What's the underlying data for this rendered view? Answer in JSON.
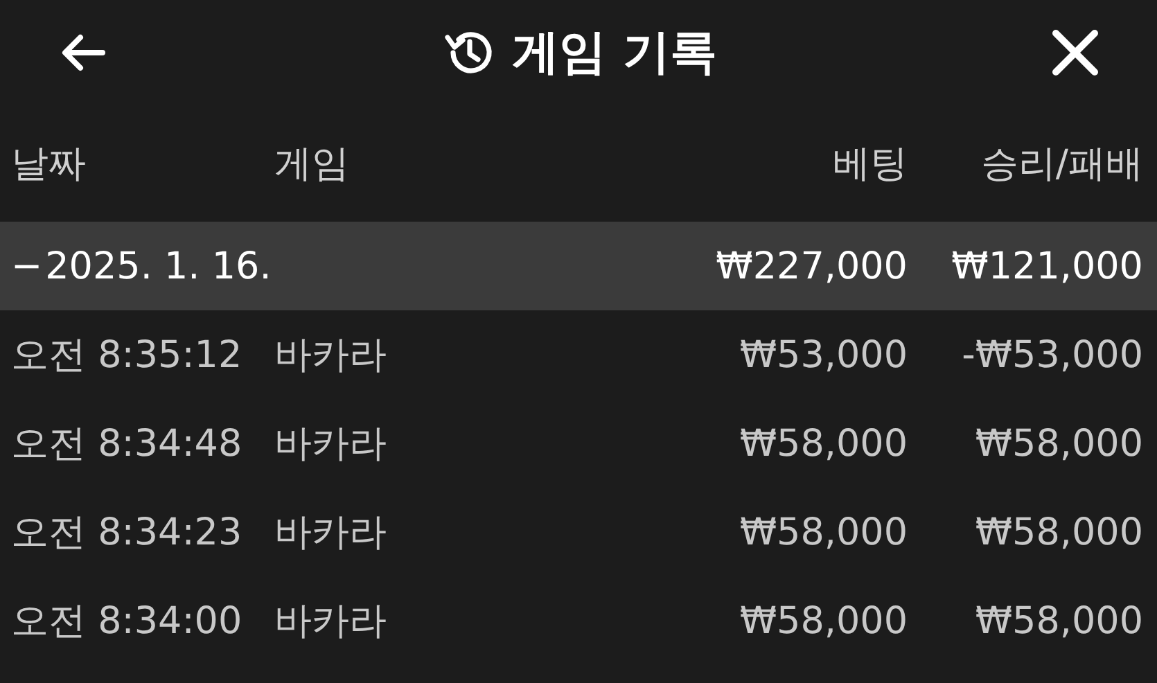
{
  "header": {
    "title": "게임 기록"
  },
  "table": {
    "columns": [
      "날짜",
      "게임",
      "베팅",
      "승리/패배"
    ],
    "groups": [
      {
        "toggle": "−",
        "date": "2025. 1. 16.",
        "expanded": true,
        "bet_total": "₩227,000",
        "result_total": "₩121,000",
        "rows": [
          {
            "time": "오전 8:35:12",
            "game": "바카라",
            "bet": "₩53,000",
            "result": "-₩53,000"
          },
          {
            "time": "오전 8:34:48",
            "game": "바카라",
            "bet": "₩58,000",
            "result": "₩58,000"
          },
          {
            "time": "오전 8:34:23",
            "game": "바카라",
            "bet": "₩58,000",
            "result": "₩58,000"
          },
          {
            "time": "오전 8:34:00",
            "game": "바카라",
            "bet": "₩58,000",
            "result": "₩58,000"
          }
        ]
      }
    ]
  }
}
